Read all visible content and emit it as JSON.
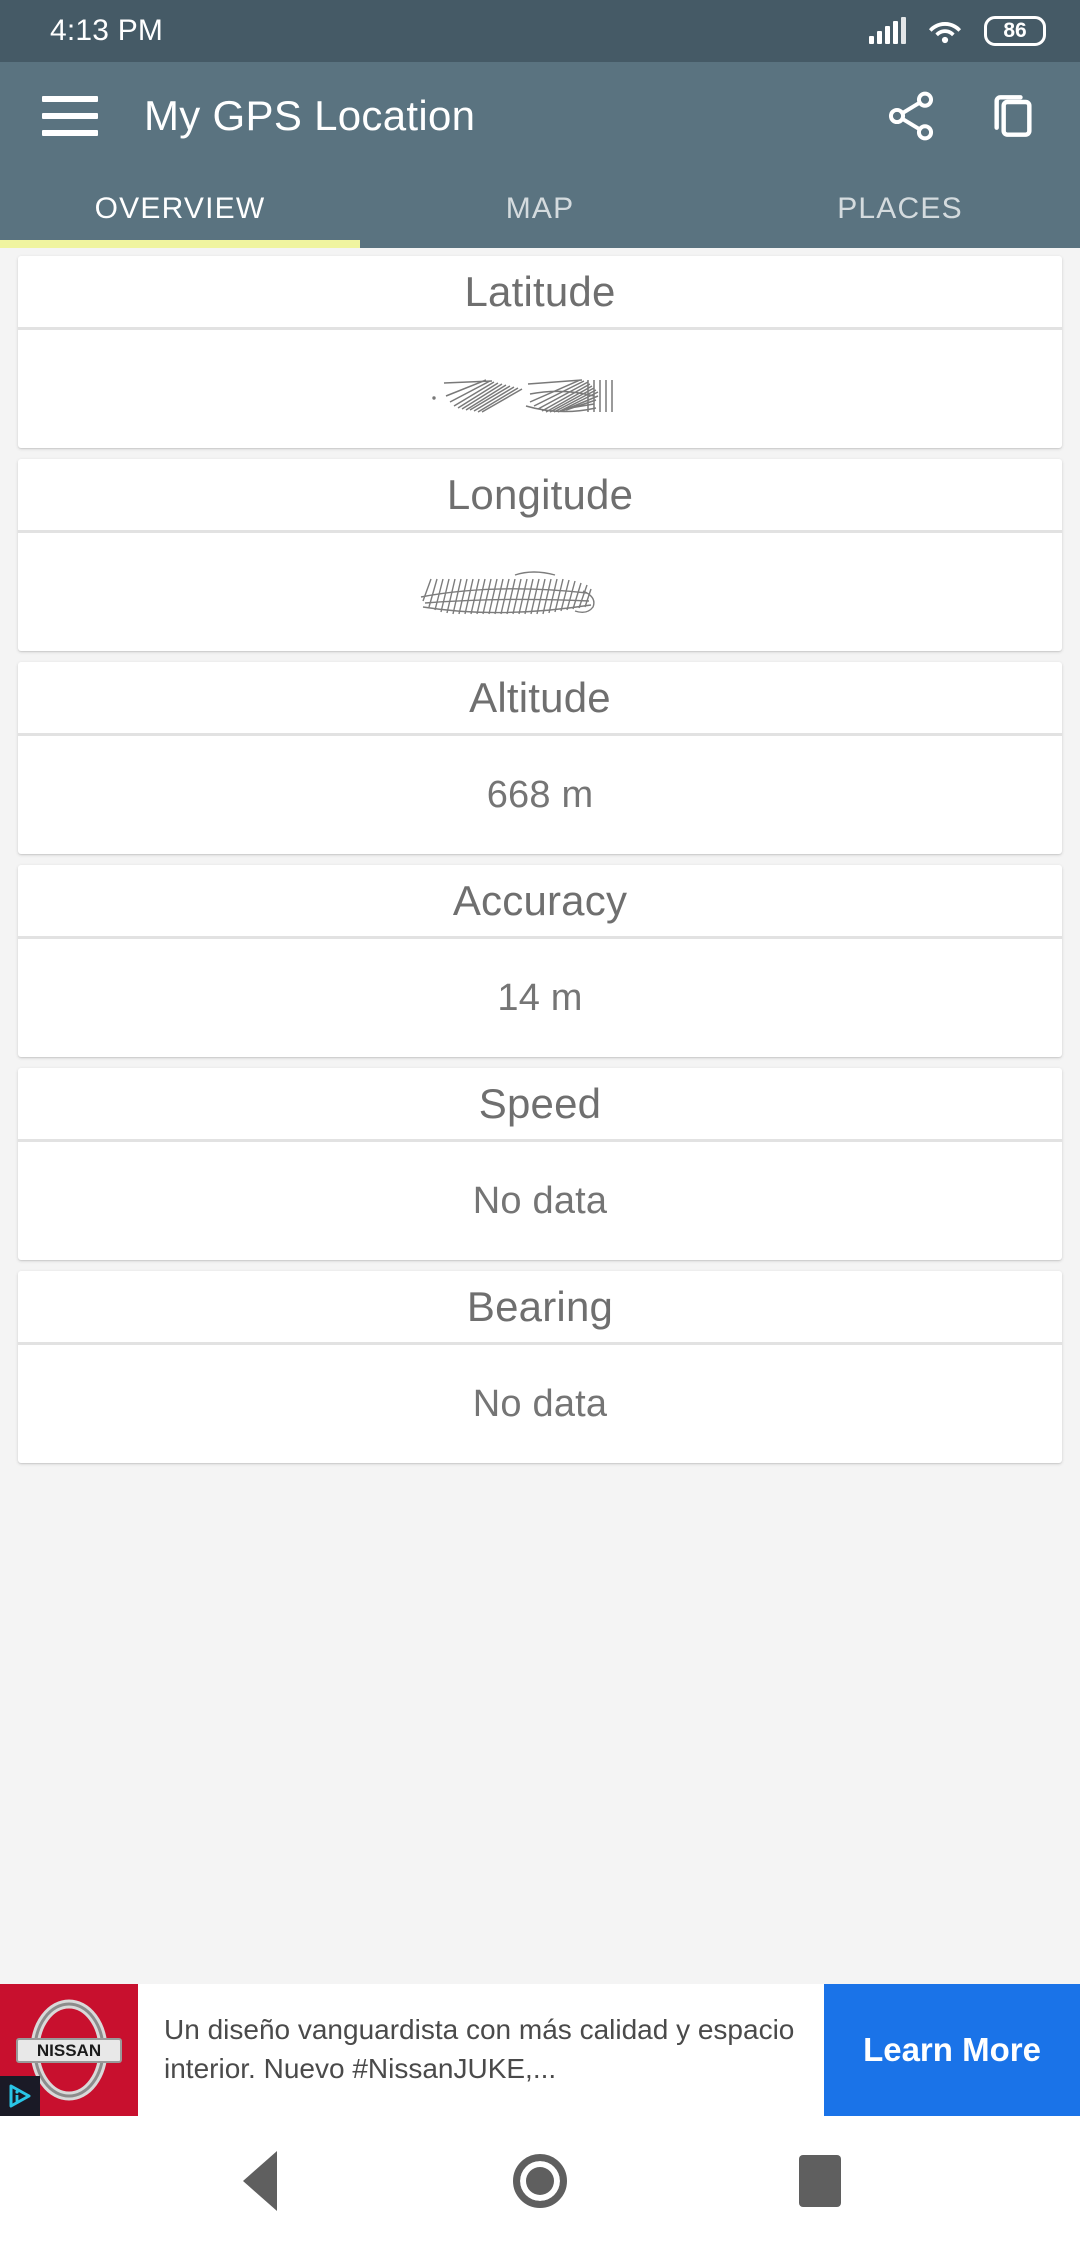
{
  "statusbar": {
    "time": "4:13 PM",
    "battery_level": "86",
    "signal_icon": "cellular-signal-icon",
    "wifi_icon": "wifi-icon",
    "battery_icon": "battery-icon"
  },
  "appbar": {
    "title": "My GPS Location",
    "menu_icon": "hamburger-menu-icon",
    "share_icon": "share-icon",
    "copy_icon": "copy-icon"
  },
  "tabs": [
    {
      "label": "OVERVIEW",
      "active": true
    },
    {
      "label": "MAP",
      "active": false
    },
    {
      "label": "PLACES",
      "active": false
    }
  ],
  "cards": [
    {
      "title": "Latitude",
      "value": "",
      "redacted": true
    },
    {
      "title": "Longitude",
      "value": "",
      "redacted": true
    },
    {
      "title": "Altitude",
      "value": "668 m",
      "redacted": false
    },
    {
      "title": "Accuracy",
      "value": "14 m",
      "redacted": false
    },
    {
      "title": "Speed",
      "value": "No data",
      "redacted": false
    },
    {
      "title": "Bearing",
      "value": "No data",
      "redacted": false
    }
  ],
  "ad": {
    "brand": "NISSAN",
    "body": "Un diseño vanguardista con más calidad y espacio interior. Nuevo #NissanJUKE,...",
    "cta_label": "Learn More",
    "adchoices_icon": "adchoices-icon",
    "brand_color": "#c8102e",
    "cta_color": "#1a73e8"
  },
  "navbar": {
    "back_icon": "back-triangle-icon",
    "home_icon": "home-circle-icon",
    "recents_icon": "recents-square-icon"
  },
  "theme": {
    "status_bar_color": "#455a66",
    "app_bar_color": "#5a7380",
    "tab_indicator_color": "#f0f4a0",
    "page_background": "#f4f4f4"
  }
}
